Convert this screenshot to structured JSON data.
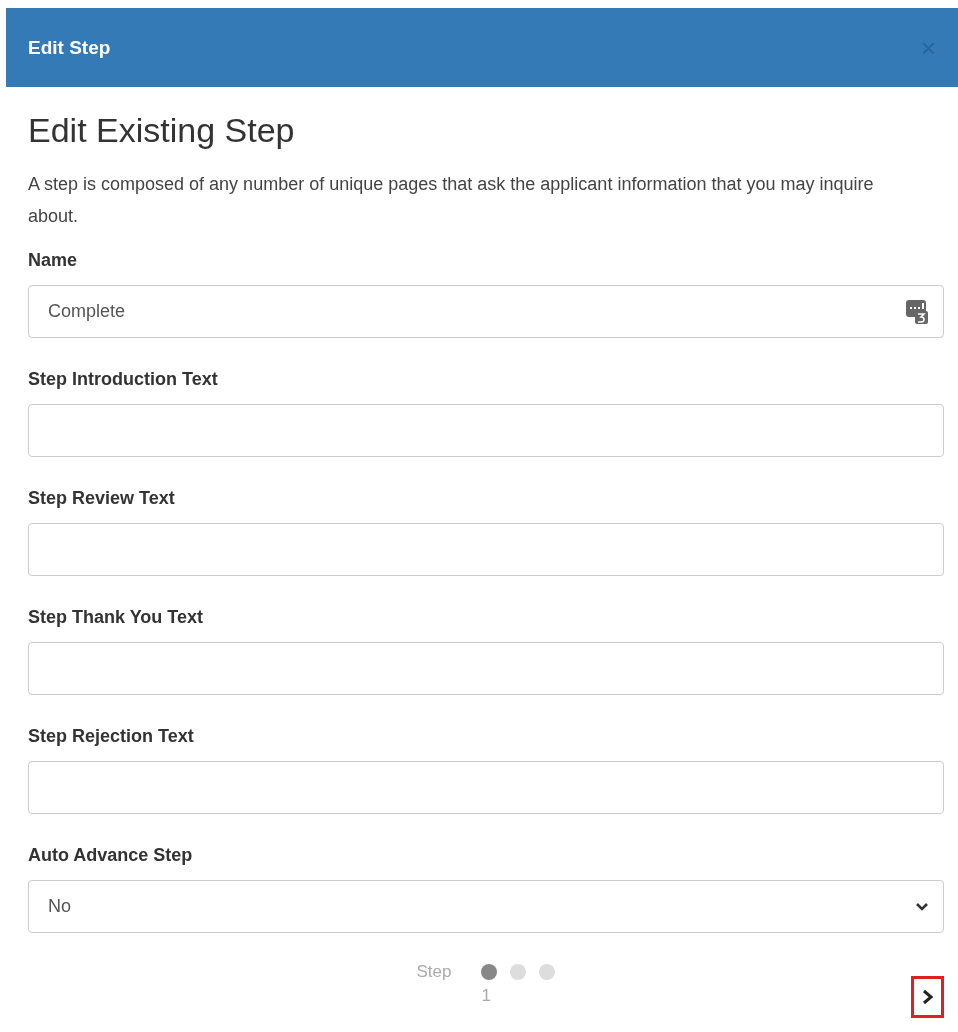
{
  "window": {
    "title": "Edit Step",
    "close": "×"
  },
  "heading": "Edit Existing Step",
  "description": "A step is composed of any number of unique pages that ask the applicant information that you may inquire about.",
  "fields": [
    {
      "kind": "text",
      "label": "Name",
      "value": "Complete",
      "badge": true
    },
    {
      "kind": "text",
      "label": "Step Introduction Text"
    },
    {
      "kind": "text",
      "label": "Step Review Text"
    },
    {
      "kind": "text",
      "label": "Step Thank You Text"
    },
    {
      "kind": "text",
      "label": "Step Rejection Text"
    },
    {
      "kind": "select",
      "label": "Auto Advance Step",
      "value": "No"
    }
  ],
  "stepper": {
    "label": "Step",
    "number": "1",
    "dots": [
      {
        "selected": true
      },
      {
        "selected": false
      },
      {
        "selected": false
      }
    ]
  }
}
